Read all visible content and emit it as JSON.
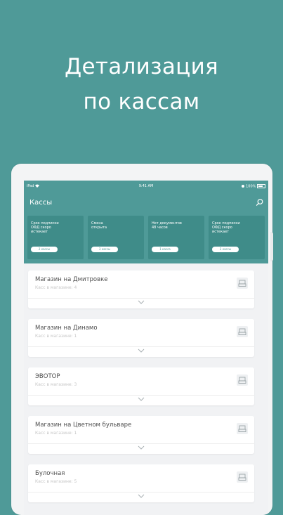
{
  "headline": {
    "line1": "Детализация",
    "line2": "по кассам"
  },
  "status_bar": {
    "carrier": "iPad",
    "time": "9:41 AM",
    "battery": "100%"
  },
  "app": {
    "title": "Кассы",
    "summary_cards": [
      {
        "text": "Срок подписки\nОФД скоро\nистекает",
        "button": "2 кассы"
      },
      {
        "text": "Сменa\nоткрыта",
        "button": "3 кассы"
      },
      {
        "text": "Нет документов\n48 часов",
        "button": "1 касса"
      },
      {
        "text": "Срок подписки\nОФД скоро\nистекает",
        "button": "2 кассы"
      }
    ],
    "stores": [
      {
        "name": "Магазин на Дмитровке",
        "subtitle": "Касс в магазине: 4"
      },
      {
        "name": "Магазин на Динамо",
        "subtitle": "Касс в магазине: 1"
      },
      {
        "name": "ЭВОТОР",
        "subtitle": "Касс в магазине: 3"
      },
      {
        "name": "Магазин на Цветном бульваре",
        "subtitle": "Касс в магазине: 1"
      },
      {
        "name": "Булочная",
        "subtitle": "Касс в магазине: 5"
      }
    ]
  },
  "colors": {
    "brand": "#4f9a98",
    "card": "#3f8c89",
    "background": "#f1f2f4"
  },
  "icons": [
    "wifi-icon",
    "battery-icon",
    "search-icon",
    "cash-register-icon",
    "chevron-down-icon"
  ]
}
